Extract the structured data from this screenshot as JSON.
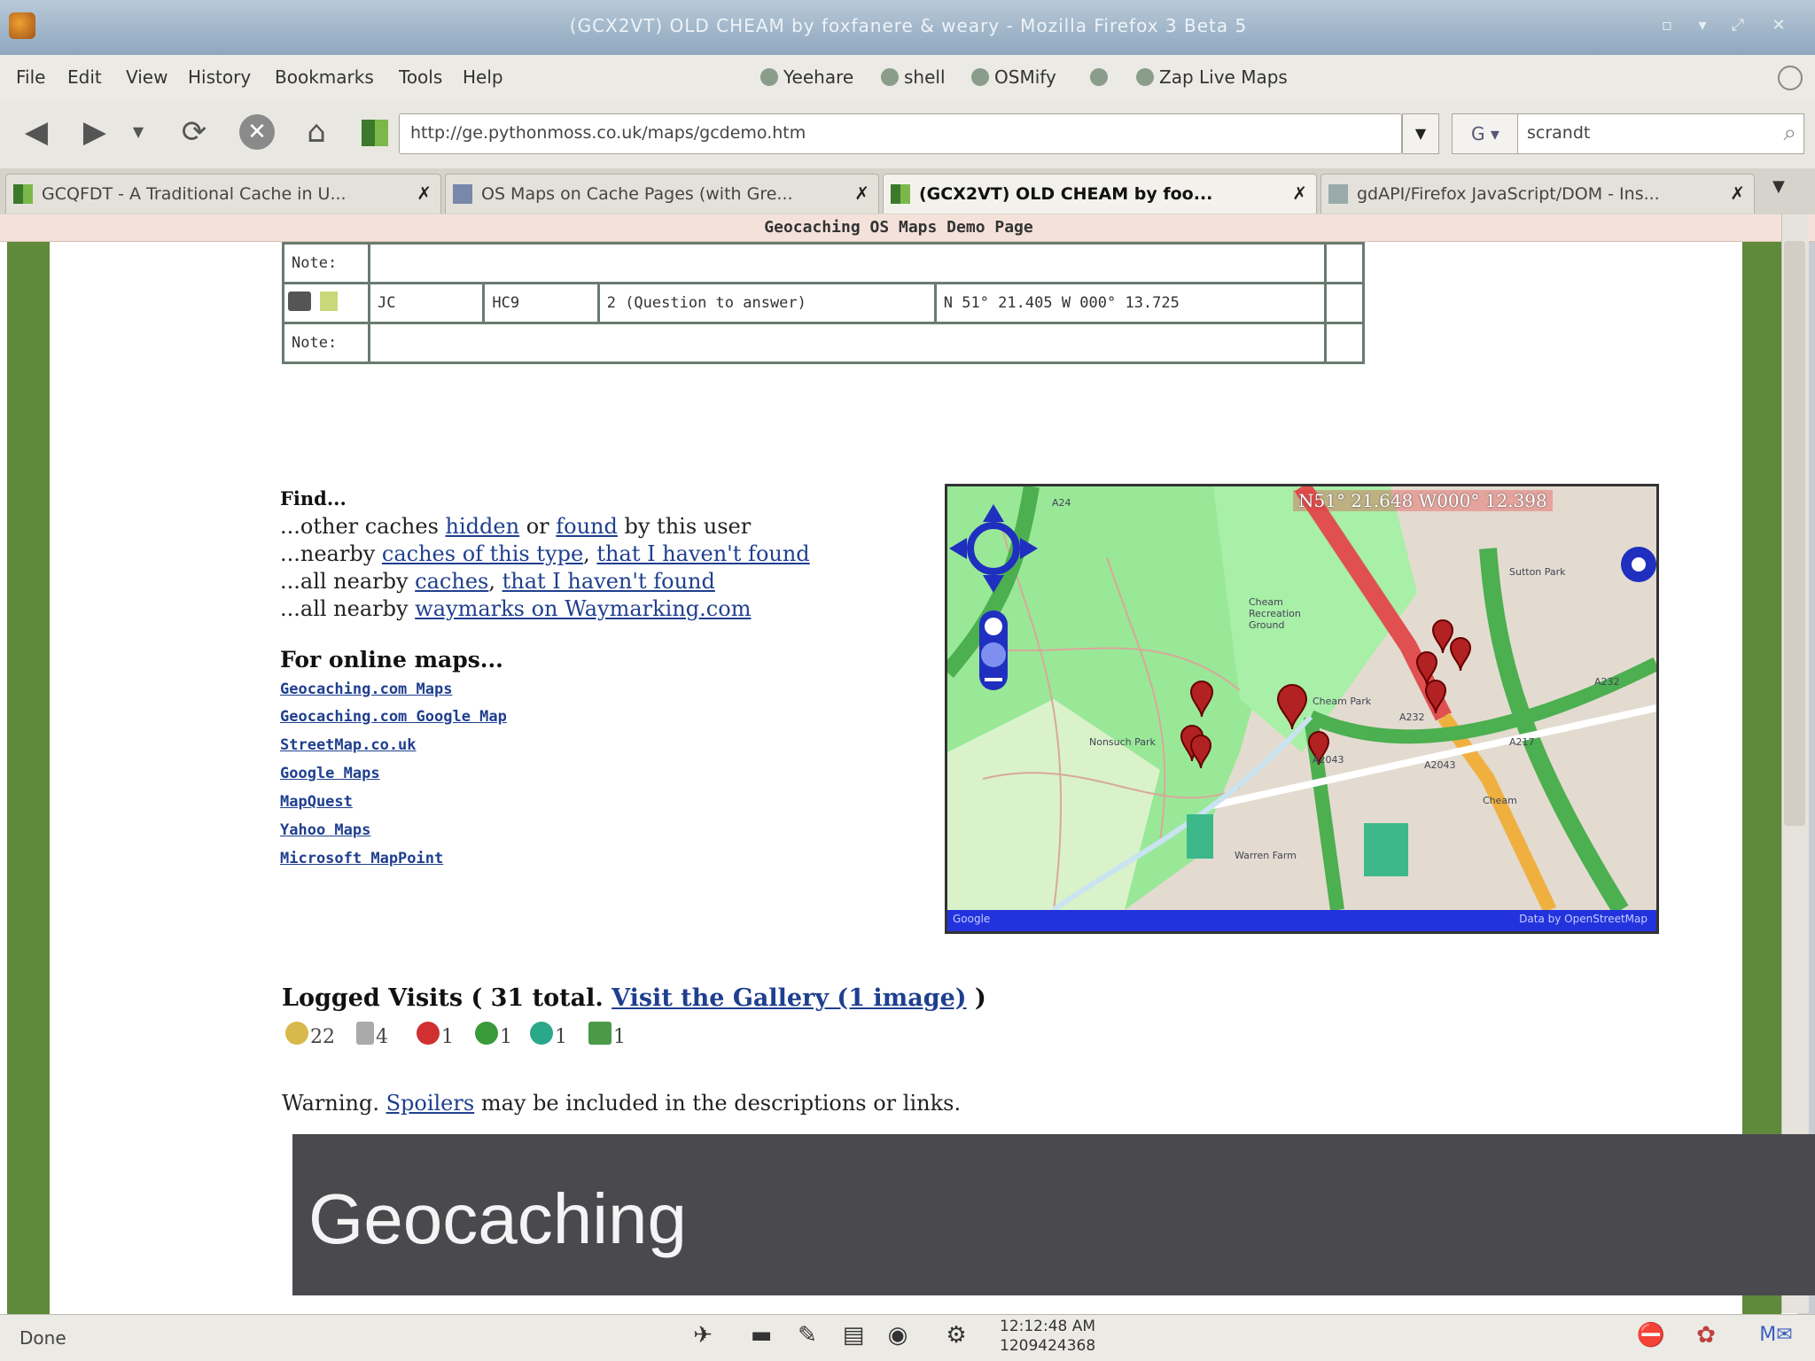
{
  "window": {
    "title": "(GCX2VT) OLD CHEAM by foxfanere & weary - Mozilla Firefox 3 Beta 5"
  },
  "menubar": {
    "items": [
      "File",
      "Edit",
      "View",
      "History",
      "Bookmarks",
      "Tools",
      "Help"
    ],
    "bookmarks": [
      "Yeehare",
      "shell",
      "OSMify",
      "",
      "Zap Live Maps"
    ]
  },
  "navbar": {
    "url": "http://ge.pythonmoss.co.uk/maps/gcdemo.htm",
    "search_value": "scrandt"
  },
  "tabs": [
    {
      "label": "GCQFDT - A Traditional Cache in U...",
      "active": false
    },
    {
      "label": "OS Maps on Cache Pages (with Gre...",
      "active": false
    },
    {
      "label": "(GCX2VT) OLD CHEAM by foo...",
      "active": true
    },
    {
      "label": "gdAPI/Firefox JavaScript/DOM - Ins...",
      "active": false
    }
  ],
  "page": {
    "title": "Geocaching OS Maps Demo Page",
    "table": {
      "row1_note": "Note:",
      "row2": {
        "prefix": "JC",
        "lookup": "HC9",
        "name": "2 (Question to answer)",
        "coords": "N 51° 21.405 W 000° 13.725"
      },
      "row2_note": "Note:"
    },
    "find": {
      "heading": "Find...",
      "line1_pre": "...other caches ",
      "line1_link1": "hidden",
      "line1_mid": " or ",
      "line1_link2": "found",
      "line1_post": " by this user",
      "line2_pre": "...nearby ",
      "line2_link1": "caches of this type",
      "line2_mid": ", ",
      "line2_link2": "that I haven't found",
      "line3_pre": "...all nearby ",
      "line3_link1": "caches",
      "line3_mid": ", ",
      "line3_link2": "that I haven't found",
      "line4_pre": "...all nearby ",
      "line4_link": "waymarks on Waymarking.com"
    },
    "online_maps": {
      "heading": "For online maps...",
      "links": [
        "Geocaching.com Maps",
        "Geocaching.com Google Map",
        "StreetMap.co.uk",
        "Google Maps",
        "MapQuest",
        "Yahoo Maps",
        "Microsoft MapPoint"
      ]
    },
    "map": {
      "coords": "N51° 21.648 W000° 12.398",
      "road_labels": [
        "A24",
        "A232",
        "A232",
        "A217",
        "A2043",
        "A2043"
      ],
      "area_labels": [
        "Cheam Recreation Ground",
        "Nonsuch Park",
        "Cheam Park",
        "Sutton Park",
        "Cheam",
        "Warren Farm"
      ],
      "copyright_left": "Google",
      "copyright_right": "Data by OpenStreetMap"
    },
    "visits": {
      "heading_pre": "Logged Visits ( 31 total. ",
      "gallery_link": "Visit the Gallery (1 image)",
      "heading_post": " )",
      "stats": [
        "22",
        "4",
        "1",
        "1",
        "1",
        "1"
      ]
    },
    "warning": {
      "pre": "Warning. ",
      "link": "Spoilers",
      "post": " may be included in the descriptions or links."
    }
  },
  "caption": {
    "text": "Geocaching"
  },
  "statusbar": {
    "status": "Done",
    "clock_time": "12:12:48 AM",
    "clock_epoch": "1209424368"
  },
  "colors": {
    "page_border_green": "#5f8a3a",
    "link_blue": "#1f3f8f",
    "caption_bg": "#4a494d"
  }
}
